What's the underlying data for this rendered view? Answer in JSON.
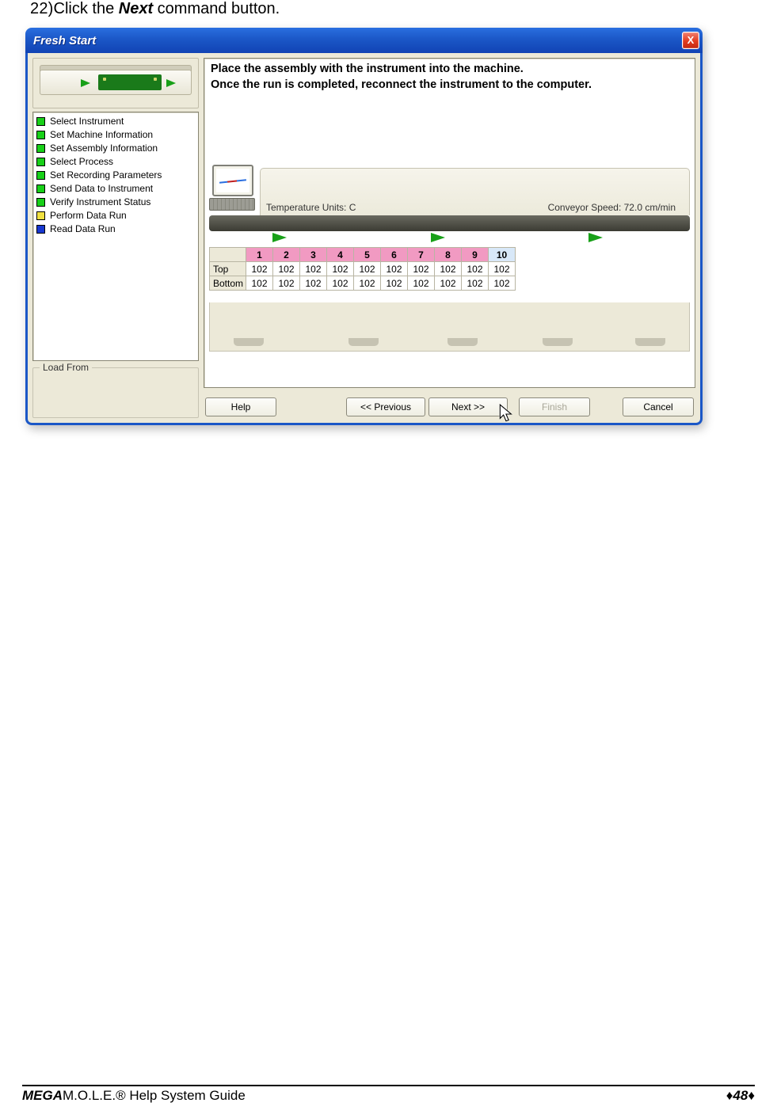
{
  "instruction": {
    "number": "22)",
    "pre": "Click the ",
    "bold": "Next",
    "post": " command button."
  },
  "dialog": {
    "title": "Fresh Start",
    "close_glyph": "X",
    "headline_l1": "Place the assembly with the instrument into the machine.",
    "headline_l2": "Once the run is completed, reconnect the instrument to the computer.",
    "steps": [
      {
        "color": "green",
        "label": "Select Instrument"
      },
      {
        "color": "green",
        "label": "Set Machine Information"
      },
      {
        "color": "green",
        "label": "Set Assembly Information"
      },
      {
        "color": "green",
        "label": "Select Process"
      },
      {
        "color": "green",
        "label": "Set Recording Parameters"
      },
      {
        "color": "green",
        "label": "Send Data to Instrument"
      },
      {
        "color": "green",
        "label": "Verify Instrument Status"
      },
      {
        "color": "yellow",
        "label": "Perform Data Run"
      },
      {
        "color": "blue",
        "label": "Read Data Run"
      }
    ],
    "load_from_label": "Load From",
    "temp_units": "Temperature Units: C",
    "conveyor_speed": "Conveyor Speed: 72.0  cm/min",
    "chart_data": {
      "type": "table",
      "columns": [
        "1",
        "2",
        "3",
        "4",
        "5",
        "6",
        "7",
        "8",
        "9",
        "10"
      ],
      "selected_column_index": 9,
      "rows": [
        {
          "label": "Top",
          "values": [
            102,
            102,
            102,
            102,
            102,
            102,
            102,
            102,
            102,
            102
          ]
        },
        {
          "label": "Bottom",
          "values": [
            102,
            102,
            102,
            102,
            102,
            102,
            102,
            102,
            102,
            102
          ]
        }
      ]
    },
    "buttons": {
      "help": "Help",
      "prev": "<< Previous",
      "next": "Next >>",
      "finish": "Finish",
      "cancel": "Cancel"
    }
  },
  "footer": {
    "left_bold": "MEGA",
    "left_rest": "M.O.L.E.® Help System Guide",
    "right": "♦48♦"
  }
}
